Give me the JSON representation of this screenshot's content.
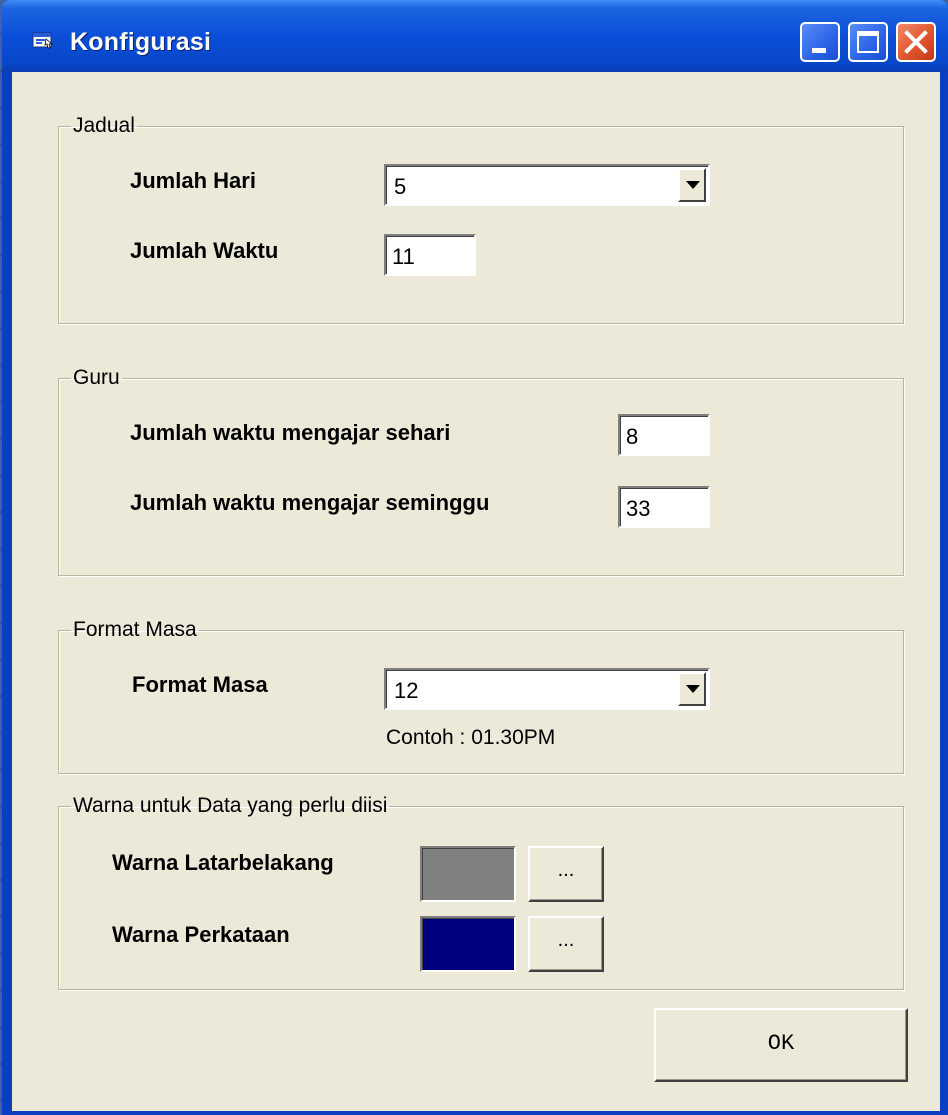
{
  "window": {
    "title": "Konfigurasi"
  },
  "jadual": {
    "legend": "Jadual",
    "jumlah_hari_label": "Jumlah Hari",
    "jumlah_hari_value": "5",
    "jumlah_waktu_label": "Jumlah Waktu",
    "jumlah_waktu_value": "11"
  },
  "guru": {
    "legend": "Guru",
    "sehari_label": "Jumlah waktu mengajar sehari",
    "sehari_value": "8",
    "seminggu_label": "Jumlah waktu mengajar seminggu",
    "seminggu_value": "33"
  },
  "format_masa": {
    "legend": "Format Masa",
    "label": "Format Masa",
    "value": "12",
    "example": "Contoh : 01.30PM"
  },
  "warna": {
    "legend": "Warna untuk Data yang perlu diisi",
    "latar_label": "Warna Latarbelakang",
    "latar_color": "#808080",
    "latar_button": "...",
    "perkataan_label": "Warna Perkataan",
    "perkataan_color": "#000080",
    "perkataan_button": "..."
  },
  "buttons": {
    "ok": "OK"
  },
  "icons": {
    "title_icon": "app-window-icon",
    "minimize": "minimize-icon",
    "maximize": "maximize-icon",
    "close": "close-icon",
    "dropdown": "chevron-down-icon"
  }
}
